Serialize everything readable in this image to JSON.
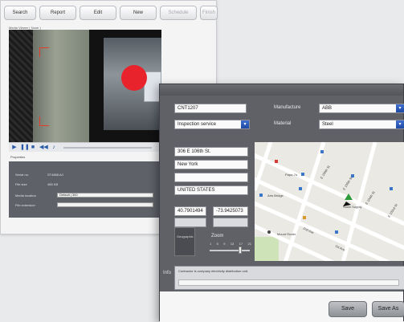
{
  "toolbar": {
    "buttons": [
      "Search",
      "Report",
      "Edit",
      "New",
      "Schedule",
      "Finish"
    ]
  },
  "media": {
    "caption": "Media Viewer ( None )"
  },
  "properties": {
    "tabs": [
      "Properties"
    ],
    "fields": [
      {
        "label": "Serial no.",
        "value": "ST4888 A/I"
      },
      {
        "label": "File size",
        "value": "485 KB"
      },
      {
        "label": "Media location",
        "value": "Default | 300"
      },
      {
        "label": "File extension",
        "value": ""
      }
    ]
  },
  "dialog": {
    "fields": {
      "asset_id": "CNT1207",
      "type": "Inspection service",
      "manufacturer_label": "Manufacture",
      "manufacturer": "ABB",
      "material_label": "Material",
      "material": "Steel",
      "street": "306 E 106th St.",
      "city": "New York",
      "address_extra": "",
      "country": "UNITED STATES",
      "latitude": "40.7901494",
      "longitude": "-73.9425073"
    },
    "zoom": {
      "label": "Zoom",
      "ticks": [
        "1",
        "5",
        "9",
        "13",
        "17",
        "21"
      ]
    },
    "zoom_box_text": "Geographic",
    "info_label": "Info",
    "info_text": "Contractor is company electricity distribution unit.",
    "buttons": {
      "save": "Save",
      "save_as": "Save As"
    }
  },
  "map": {
    "streets": [
      "E 106th St",
      "E 105th St",
      "E 104th St",
      "E 103rd St",
      "2nd Ave",
      "1st Ave"
    ],
    "places": [
      "Papa J's",
      "Arts Bridge",
      "Sushi Supply",
      "Mount Ruder"
    ],
    "colors": {
      "park": "#cfe3b9",
      "road": "#ffffff",
      "pin": "#2f9c3b",
      "poi": "#3a77c9",
      "poi_red": "#d93b34"
    }
  },
  "colors": {
    "accent_red": "#e8232c",
    "select_blue": "#2f5dc0"
  }
}
